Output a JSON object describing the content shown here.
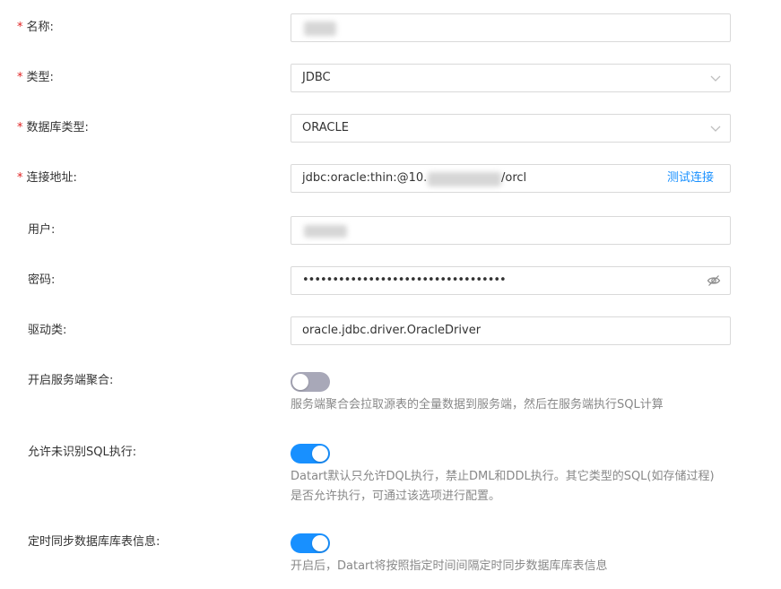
{
  "form": {
    "name": {
      "label": "名称:",
      "value": ""
    },
    "type": {
      "label": "类型:",
      "value": "JDBC"
    },
    "db_type": {
      "label": "数据库类型:",
      "value": "ORACLE"
    },
    "url": {
      "label": "连接地址:",
      "value_prefix": "jdbc:oracle:thin:@10.",
      "value_suffix": "/orcl",
      "test_link": "测试连接"
    },
    "user": {
      "label": "用户:",
      "value": ""
    },
    "password": {
      "label": "密码:",
      "value": "••••••••••••••••••••••••••••••••••"
    },
    "driver": {
      "label": "驱动类:",
      "value": "oracle.jdbc.driver.OracleDriver"
    },
    "server_agg": {
      "label": "开启服务端聚合:",
      "enabled": false,
      "help": "服务端聚合会拉取源表的全量数据到服务端，然后在服务端执行SQL计算"
    },
    "unknown_sql": {
      "label": "允许未识别SQL执行:",
      "enabled": true,
      "help_line1": "Datart默认只允许DQL执行，禁止DML和DDL执行。其它类型的SQL(如存储过程)",
      "help_line2": "是否允许执行，可通过该选项进行配置。"
    },
    "sync_meta": {
      "label": "定时同步数据库库表信息:",
      "enabled": true,
      "help": "开启后，Datart将按照指定时间间隔定时同步数据库库表信息"
    },
    "required_mark": "*"
  },
  "icons": {
    "select_arrow": "chevron-down-icon",
    "password_toggle": "eye-invisible-icon"
  },
  "colors": {
    "accent": "#1890ff",
    "required": "#e02020",
    "switch_off": "#a8a8b8"
  }
}
